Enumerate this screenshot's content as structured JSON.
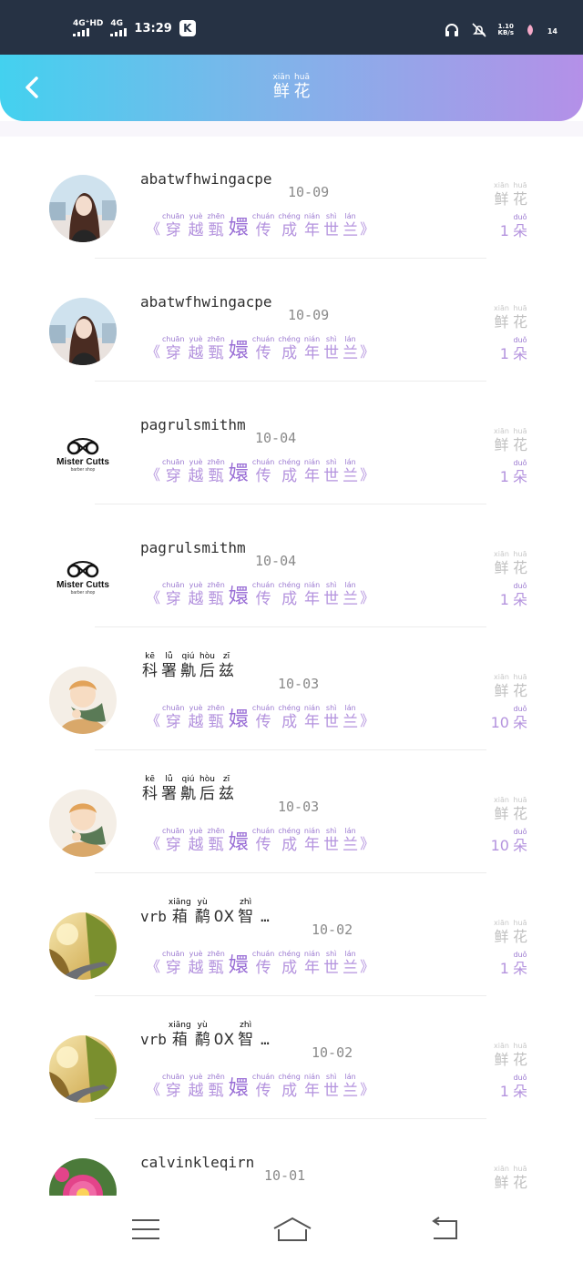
{
  "status_bar": {
    "network1": "4G⁺HD",
    "network2": "4G",
    "time": "13:29",
    "app_badge": "K",
    "speed_top": "1.10",
    "speed_unit": "KB/s",
    "battery": "14"
  },
  "header": {
    "title": [
      {
        "py": "xiān",
        "hz": "鲜"
      },
      {
        "py": "huā",
        "hz": "花"
      }
    ]
  },
  "book_title": [
    {
      "py": "chuān",
      "hz": "穿"
    },
    {
      "py": "yuè",
      "hz": "越"
    },
    {
      "py": "zhēn",
      "hz": "甄"
    },
    {
      "py": "",
      "hz": "嬛",
      "big": true
    },
    {
      "py": "chuán",
      "hz": "传"
    },
    {
      "py": "chéng",
      "hz": "成"
    },
    {
      "py": "nián",
      "hz": "年"
    },
    {
      "py": "shì",
      "hz": "世"
    },
    {
      "py": "lán",
      "hz": "兰"
    }
  ],
  "flower_label": [
    {
      "py": "xiān",
      "hz": "鲜"
    },
    {
      "py": "huā",
      "hz": "花"
    }
  ],
  "unit": {
    "py": "duǒ",
    "hz": "朵"
  },
  "quote_open": "《",
  "quote_close": "》",
  "rows": [
    {
      "avatar": "girl-photo",
      "name": "abatwfhwingacpe",
      "date": "10-09",
      "count": "1"
    },
    {
      "avatar": "girl-photo",
      "name": "abatwfhwingacpe",
      "date": "10-09",
      "count": "1"
    },
    {
      "avatar": "mister-cutts-logo",
      "name": "pagrulsmithm",
      "date": "10-04",
      "count": "1",
      "logo_text": "Mister Cutts",
      "logo_sub": "barber shop"
    },
    {
      "avatar": "mister-cutts-logo",
      "name": "pagrulsmithm",
      "date": "10-04",
      "count": "1",
      "logo_text": "Mister Cutts",
      "logo_sub": "barber shop"
    },
    {
      "avatar": "boy-illustration",
      "name_ruby": [
        {
          "py": "kē",
          "hz": "科"
        },
        {
          "py": "lǚ",
          "hz": "署"
        },
        {
          "py": "qiú",
          "hz": "鼽"
        },
        {
          "py": "hòu",
          "hz": "后"
        },
        {
          "py": "zī",
          "hz": "兹"
        }
      ],
      "date": "10-03",
      "count": "10"
    },
    {
      "avatar": "boy-illustration",
      "name_ruby": [
        {
          "py": "kē",
          "hz": "科"
        },
        {
          "py": "lǚ",
          "hz": "署"
        },
        {
          "py": "qiú",
          "hz": "鼽"
        },
        {
          "py": "hòu",
          "hz": "后"
        },
        {
          "py": "zī",
          "hz": "兹"
        }
      ],
      "date": "10-03",
      "count": "10"
    },
    {
      "avatar": "road-landscape",
      "name_prefix": "vrb",
      "name_ruby": [
        {
          "py": "xiāng",
          "hz": "葙"
        },
        {
          "py": "yù",
          "hz": "鹬"
        },
        {
          "py": "",
          "hz": "0X"
        },
        {
          "py": "zhì",
          "hz": "智"
        }
      ],
      "name_suffix": "…",
      "date": "10-02",
      "count": "1"
    },
    {
      "avatar": "road-landscape",
      "name_prefix": "vrb",
      "name_ruby": [
        {
          "py": "xiāng",
          "hz": "葙"
        },
        {
          "py": "yù",
          "hz": "鹬"
        },
        {
          "py": "",
          "hz": "0X"
        },
        {
          "py": "zhì",
          "hz": "智"
        }
      ],
      "name_suffix": "…",
      "date": "10-02",
      "count": "1"
    },
    {
      "avatar": "pink-flower",
      "name": "calvinkleqirn",
      "date": "10-01",
      "count": ""
    }
  ],
  "colors": {
    "header_start": "#43d1ef",
    "header_end": "#b490e8",
    "accent_purple": "#b493de",
    "status_bar": "#263244"
  },
  "nav": {
    "menu_icon": "menu-icon",
    "home_icon": "home-icon",
    "back_icon": "back-arrow-icon"
  }
}
